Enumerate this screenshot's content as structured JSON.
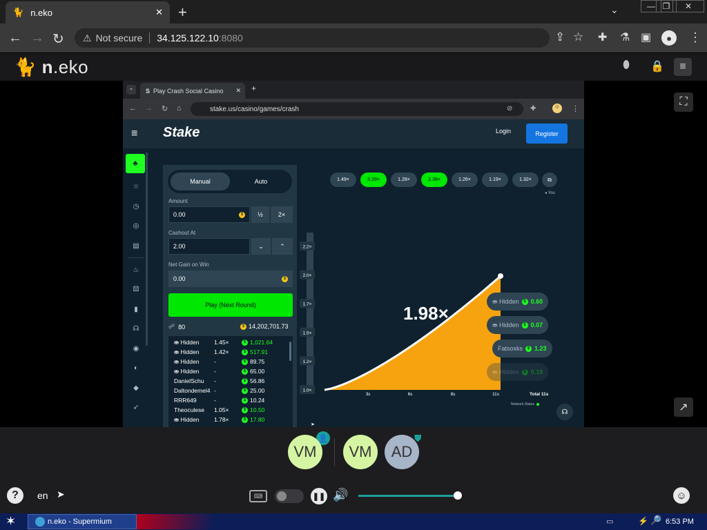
{
  "browser": {
    "tab_title": "n.eko",
    "close": "✕",
    "new_tab": "+",
    "not_secure": "Not secure",
    "host": "34.125.122.10",
    "port": ":8080"
  },
  "neko": {
    "logo_prefix": "n",
    "logo_suffix": ".eko",
    "lang": "en",
    "users": [
      {
        "initials": "VM",
        "color": "#d6f5a3"
      },
      {
        "initials": "VM",
        "color": "#d6f5a3"
      },
      {
        "initials": "AD",
        "color": "#a7b5c9"
      }
    ],
    "volume_percent": 100
  },
  "inner": {
    "tab_title": "Play Crash Social Casino",
    "url": "stake.us/casino/games/crash",
    "brand": "Stake",
    "login": "Login",
    "register": "Register",
    "manual": "Manual",
    "auto": "Auto",
    "amount_label": "Amount",
    "amount_value": "0.00",
    "half": "½",
    "double": "2×",
    "cashout_label": "Cashout At",
    "cashout_value": "2.00",
    "net_label": "Net Gain on Win",
    "net_value": "0.00",
    "play": "Play (Next Round)",
    "players_count": "80",
    "total_amount": "14,202,701.73",
    "history": [
      {
        "v": "1.49×",
        "win": false
      },
      {
        "v": "3.29×",
        "win": true
      },
      {
        "v": "1.28×",
        "win": false
      },
      {
        "v": "2.38×",
        "win": true
      },
      {
        "v": "1.26×",
        "win": false
      },
      {
        "v": "1.19×",
        "win": false
      },
      {
        "v": "1.32×",
        "win": false
      }
    ],
    "you_label": "You",
    "players": [
      {
        "name": "Hidden",
        "mult": "1.45×",
        "amt": "1,021.64",
        "green": true
      },
      {
        "name": "Hidden",
        "mult": "1.42×",
        "amt": "517.91",
        "green": true
      },
      {
        "name": "Hidden",
        "mult": "-",
        "amt": "89.75",
        "green": false
      },
      {
        "name": "Hidden",
        "mult": "-",
        "amt": "65.00",
        "green": false
      },
      {
        "name": "DanielSchu",
        "mult": "-",
        "amt": "56.86",
        "green": false
      },
      {
        "name": "Daltondemel4",
        "mult": "-",
        "amt": "25.00",
        "green": false
      },
      {
        "name": "RRR649",
        "mult": "-",
        "amt": "10.24",
        "green": false
      },
      {
        "name": "Theoculese",
        "mult": "1.05×",
        "amt": "10.50",
        "green": true
      },
      {
        "name": "Hidden",
        "mult": "1.78×",
        "amt": "17.80",
        "green": true
      }
    ],
    "multiplier": "1.98×",
    "y_ticks": [
      "2.2×",
      "2.0×",
      "1.7×",
      "1.5×",
      "1.2×",
      "1.0×"
    ],
    "x_ticks": [
      "3s",
      "6s",
      "8s",
      "11s"
    ],
    "total_time": "Total 11s",
    "network_status": "Network Status",
    "cashouts": [
      {
        "name": "Hidden",
        "amt": "0.60",
        "faded": false
      },
      {
        "name": "Hidden",
        "amt": "0.07",
        "faded": false
      },
      {
        "name": "Fatsoxks",
        "amt": "1.23",
        "faded": false
      },
      {
        "name": "Hidden",
        "amt": "0.18",
        "faded": true
      }
    ]
  },
  "taskbar": {
    "task": "n.eko - Supermium",
    "time": "6:53 PM"
  }
}
